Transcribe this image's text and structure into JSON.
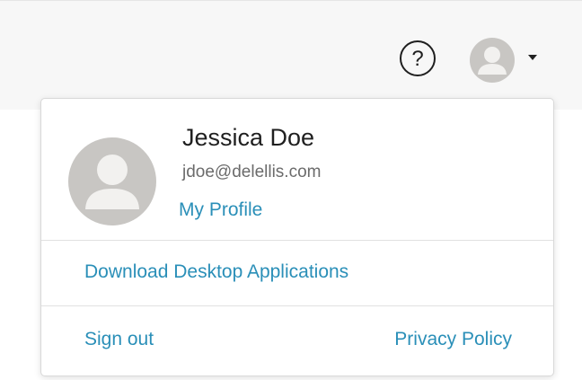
{
  "header": {
    "help_icon": "question-circle-icon",
    "avatar_icon": "user-avatar-icon",
    "menu_caret_icon": "caret-down-icon"
  },
  "user_menu": {
    "avatar_icon": "user-avatar-icon",
    "name": "Jessica Doe",
    "email": "jdoe@delellis.com",
    "my_profile_label": "My Profile",
    "download_label": "Download Desktop Applications",
    "sign_out_label": "Sign out",
    "privacy_policy_label": "Privacy Policy"
  },
  "colors": {
    "link": "#2a8fb8",
    "avatar_bg": "#c8c6c3",
    "avatar_fg": "#f2f1ef",
    "header_bg": "#f7f7f7"
  }
}
